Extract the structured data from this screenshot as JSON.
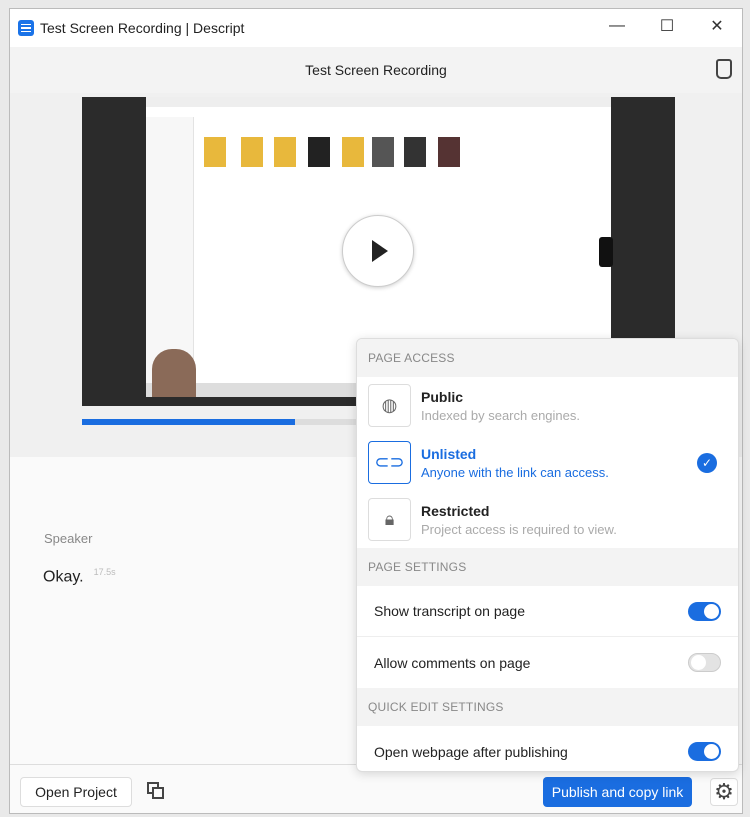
{
  "window": {
    "title": "Test Screen Recording | Descript"
  },
  "header": {
    "title": "Test Screen Recording"
  },
  "player": {
    "progress_percent": 36
  },
  "transcript": {
    "speaker": "Speaker",
    "text": "Okay.",
    "gap": "17.5s"
  },
  "footer": {
    "open_project": "Open Project",
    "publish": "Publish and copy link"
  },
  "popover": {
    "page_access": "PAGE ACCESS",
    "options": [
      {
        "title": "Public",
        "desc": "Indexed by search engines.",
        "selected": false
      },
      {
        "title": "Unlisted",
        "desc": "Anyone with the link can access.",
        "selected": true
      },
      {
        "title": "Restricted",
        "desc": "Project access is required to view.",
        "selected": false
      }
    ],
    "page_settings": "PAGE SETTINGS",
    "show_transcript": "Show transcript on page",
    "allow_comments": "Allow comments on page",
    "quick_edit": "QUICK EDIT SETTINGS",
    "open_webpage": "Open webpage after publishing",
    "toggles": {
      "show_transcript": true,
      "allow_comments": false,
      "open_webpage": true
    }
  }
}
